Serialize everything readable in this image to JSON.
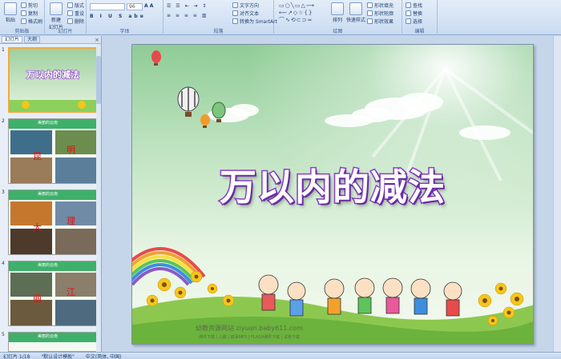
{
  "ribbon": {
    "clipboard": {
      "label": "剪贴板",
      "paste": "粘贴",
      "cut": "剪切",
      "copy": "复制",
      "format_painter": "格式刷"
    },
    "slides": {
      "label": "幻灯片",
      "new_slide": "新建\n幻灯片",
      "layout": "版式",
      "reset": "重设",
      "delete": "删除"
    },
    "font": {
      "label": "字体",
      "font_size": "96"
    },
    "paragraph": {
      "label": "段落",
      "text_direction": "文字方向",
      "align_text": "对齐文本",
      "smartart": "转换为 SmartArt"
    },
    "drawing": {
      "label": "绘图",
      "arrange": "排列",
      "quick_styles": "快速样式",
      "shape_fill": "形状填充",
      "shape_outline": "形状轮廓",
      "shape_effects": "形状效果"
    },
    "editing": {
      "label": "编辑",
      "find": "查找",
      "replace": "替换",
      "select": "选择"
    }
  },
  "left_pane": {
    "tab_slides": "幻灯片",
    "tab_outline": "大纲",
    "close": "×",
    "thumbnails": [
      {
        "number": "1",
        "title": "万以内的减法"
      },
      {
        "number": "2",
        "caption": "美丽的云南",
        "chars": [
          "昆",
          "明"
        ]
      },
      {
        "number": "3",
        "caption": "美丽的云南",
        "chars": [
          "大",
          "理"
        ]
      },
      {
        "number": "4",
        "caption": "美丽的云南",
        "chars": [
          "丽",
          "江"
        ]
      },
      {
        "number": "5",
        "caption": "美丽的云南"
      }
    ]
  },
  "slide": {
    "title": "万以内的减法",
    "watermark": "幼教资源网站  ziyuan.baby611.com",
    "footer": "课件下载 | 儿歌 | 故事MP3 | FLASH课件下载 | 试卷下载"
  },
  "status": {
    "slide_pos": "幻灯片 1/18",
    "theme": "\"默认设计模板\"",
    "language": "中文(简体, 中国)"
  }
}
